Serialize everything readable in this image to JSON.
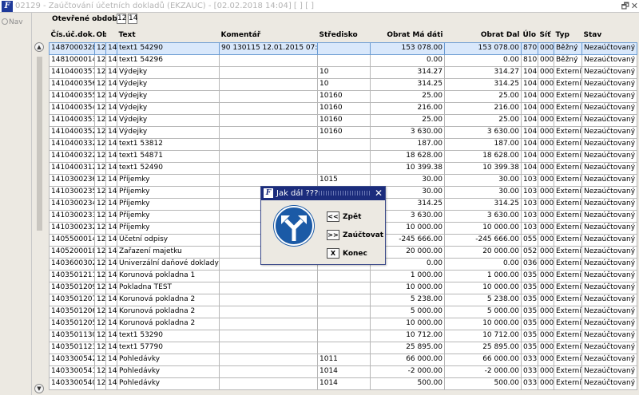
{
  "window": {
    "title": "02129 - Zaúčtování účetních dokladů (EKZAUC) - [02.02.2018  14:04]  [ ]  [ ]",
    "icon_letter": "F",
    "restore_glyph": "🗗",
    "close_glyph": "✕"
  },
  "sidebar": {
    "nav_label": "Nav"
  },
  "period": {
    "label": "Otevřené období",
    "values": [
      "12",
      "14"
    ]
  },
  "table": {
    "columns": [
      "Čís.úč.dok.",
      "Obd.",
      "",
      "Text",
      "Komentář",
      "Středisko",
      "Obrat Má dáti",
      "Obrat Dal",
      "Úlo",
      "Síť",
      "Typ",
      "Stav"
    ],
    "rows": [
      [
        "1487000328",
        "12",
        "14",
        "text1 54290",
        "90 130115 12.01.2015 07:46:0",
        "",
        "153 078.00",
        "153 078.00",
        "870",
        "000",
        "Běžný",
        "Nezaúčtovaný"
      ],
      [
        "1481000014",
        "12",
        "14",
        "text1 54296",
        "",
        "",
        "0.00",
        "0.00",
        "810",
        "000",
        "Běžný",
        "Nezaúčtovaný"
      ],
      [
        "1410400357",
        "12",
        "14",
        "Výdejky",
        "",
        "10",
        "314.27",
        "314.27",
        "104",
        "000",
        "Externí",
        "Nezaúčtovaný"
      ],
      [
        "1410400356",
        "12",
        "14",
        "Výdejky",
        "",
        "10",
        "314.25",
        "314.25",
        "104",
        "000",
        "Externí",
        "Nezaúčtovaný"
      ],
      [
        "1410400355",
        "12",
        "14",
        "Výdejky",
        "",
        "10160",
        "25.00",
        "25.00",
        "104",
        "000",
        "Externí",
        "Nezaúčtovaný"
      ],
      [
        "1410400354",
        "12",
        "14",
        "Výdejky",
        "",
        "10160",
        "216.00",
        "216.00",
        "104",
        "000",
        "Externí",
        "Nezaúčtovaný"
      ],
      [
        "1410400353",
        "12",
        "14",
        "Výdejky",
        "",
        "10160",
        "25.00",
        "25.00",
        "104",
        "000",
        "Externí",
        "Nezaúčtovaný"
      ],
      [
        "1410400352",
        "12",
        "14",
        "Výdejky",
        "",
        "10160",
        "3 630.00",
        "3 630.00",
        "104",
        "000",
        "Externí",
        "Nezaúčtovaný"
      ],
      [
        "1410400332",
        "12",
        "14",
        "text1 53812",
        "",
        "",
        "187.00",
        "187.00",
        "104",
        "000",
        "Externí",
        "Nezaúčtovaný"
      ],
      [
        "1410400322",
        "12",
        "14",
        "text1 54871",
        "",
        "",
        "18 628.00",
        "18 628.00",
        "104",
        "000",
        "Externí",
        "Nezaúčtovaný"
      ],
      [
        "1410400312",
        "12",
        "14",
        "text1 52490",
        "",
        "",
        "10 399.38",
        "10 399.38",
        "104",
        "000",
        "Externí",
        "Nezaúčtovaný"
      ],
      [
        "1410300236",
        "12",
        "14",
        "Příjemky",
        "",
        "1015",
        "30.00",
        "30.00",
        "103",
        "000",
        "Externí",
        "Nezaúčtovaný"
      ],
      [
        "1410300235",
        "12",
        "14",
        "Příjemky",
        "",
        "",
        "30.00",
        "30.00",
        "103",
        "000",
        "Externí",
        "Nezaúčtovaný"
      ],
      [
        "1410300234",
        "12",
        "14",
        "Příjemky",
        "",
        "",
        "314.25",
        "314.25",
        "103",
        "000",
        "Externí",
        "Nezaúčtovaný"
      ],
      [
        "1410300233",
        "12",
        "14",
        "Příjemky",
        "",
        "",
        "3 630.00",
        "3 630.00",
        "103",
        "000",
        "Externí",
        "Nezaúčtovaný"
      ],
      [
        "1410300232",
        "12",
        "14",
        "Příjemky",
        "",
        "",
        "10 000.00",
        "10 000.00",
        "103",
        "000",
        "Externí",
        "Nezaúčtovaný"
      ],
      [
        "1405500014",
        "12",
        "14",
        "Účetní odpisy",
        "",
        "",
        "-245 666.00",
        "-245 666.00",
        "055",
        "000",
        "Externí",
        "Nezaúčtovaný"
      ],
      [
        "1405200018",
        "12",
        "14",
        "Zařazení majetku",
        "",
        "",
        "20 000.00",
        "20 000.00",
        "052",
        "000",
        "Externí",
        "Nezaúčtovaný"
      ],
      [
        "1403600302",
        "12",
        "14",
        "Univerzální daňové doklady",
        "",
        "10",
        "0.00",
        "0.00",
        "036",
        "000",
        "Externí",
        "Nezaúčtovaný"
      ],
      [
        "1403501211",
        "12",
        "14",
        "Korunová pokladna 1",
        "",
        "",
        "1 000.00",
        "1 000.00",
        "035",
        "000",
        "Externí",
        "Nezaúčtovaný"
      ],
      [
        "1403501209",
        "12",
        "14",
        "Pokladna TEST",
        "",
        "",
        "10 000.00",
        "10 000.00",
        "035",
        "000",
        "Externí",
        "Nezaúčtovaný"
      ],
      [
        "1403501207",
        "12",
        "14",
        "Korunová pokladna 2",
        "",
        "",
        "5 238.00",
        "5 238.00",
        "035",
        "000",
        "Externí",
        "Nezaúčtovaný"
      ],
      [
        "1403501206",
        "12",
        "14",
        "Korunová pokladna 2",
        "",
        "",
        "5 000.00",
        "5 000.00",
        "035",
        "000",
        "Externí",
        "Nezaúčtovaný"
      ],
      [
        "1403501205",
        "12",
        "14",
        "Korunová pokladna 2",
        "",
        "",
        "10 000.00",
        "10 000.00",
        "035",
        "000",
        "Externí",
        "Nezaúčtovaný"
      ],
      [
        "1403501130",
        "12",
        "14",
        "text1 53290",
        "",
        "",
        "10 712.00",
        "10 712.00",
        "035",
        "000",
        "Externí",
        "Nezaúčtovaný"
      ],
      [
        "1403501123",
        "12",
        "14",
        "text1 57790",
        "",
        "",
        "25 895.00",
        "25 895.00",
        "035",
        "000",
        "Externí",
        "Nezaúčtovaný"
      ],
      [
        "1403300542",
        "12",
        "14",
        "Pohledávky",
        "",
        "1011",
        "66 000.00",
        "66 000.00",
        "033",
        "000",
        "Externí",
        "Nezaúčtovaný"
      ],
      [
        "1403300541",
        "12",
        "14",
        "Pohledávky",
        "",
        "1014",
        "-2 000.00",
        "-2 000.00",
        "033",
        "000",
        "Externí",
        "Nezaúčtovaný"
      ],
      [
        "1403300540",
        "12",
        "14",
        "Pohledávky",
        "",
        "1014",
        "500.00",
        "500.00",
        "033",
        "000",
        "Externí",
        "Nezaúčtovaný"
      ]
    ],
    "selected_row": 0,
    "scroll_up": "▲",
    "scroll_down": "▼"
  },
  "dialog": {
    "title": "Jak dál ???",
    "close": "✕",
    "icon": "split-arrow-sign-icon",
    "buttons": [
      {
        "key": "<<",
        "label": "Zpět"
      },
      {
        "key": ">>",
        "label": "Zaúčtovat"
      },
      {
        "key": "X",
        "label": "Konec"
      }
    ]
  },
  "colors": {
    "title_bar": "#1b2c7c",
    "selected_row": "#d9e8fb",
    "sign_blue": "#1b5aa6"
  }
}
